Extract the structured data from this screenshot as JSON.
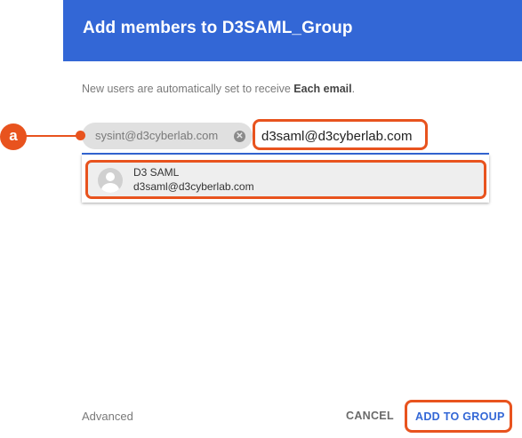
{
  "dialog": {
    "title": "Add members to D3SAML_Group",
    "info_prefix": "New users are automatically set to receive ",
    "info_bold": "Each email",
    "info_suffix": "."
  },
  "callout": {
    "label": "a",
    "color": "#e8531e"
  },
  "chips": [
    {
      "label": "sysint@d3cyberlab.com",
      "remove_icon": "close-circle-icon"
    }
  ],
  "input": {
    "value": "d3saml@d3cyberlab.com"
  },
  "suggestions": [
    {
      "name": "D3 SAML",
      "email": "d3saml@d3cyberlab.com",
      "avatar_icon": "person-icon"
    }
  ],
  "footer": {
    "advanced_label": "Advanced",
    "cancel_label": "CANCEL",
    "add_label": "ADD TO GROUP"
  },
  "colors": {
    "header": "#3367d6",
    "accent": "#3367d6",
    "highlight": "#e8531e"
  }
}
